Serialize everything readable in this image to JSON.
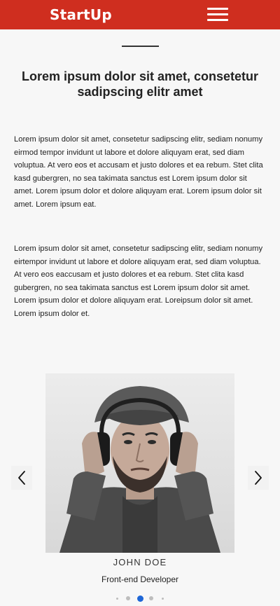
{
  "navbar": {
    "brand": "StartUp",
    "menu_icon": "hamburger-menu-icon",
    "color": "#cf2e1f"
  },
  "section": {
    "heading": "Lorem ipsum dolor sit amet, consetetur sadipscing elitr amet",
    "paragraphs": [
      "Lorem ipsum dolor sit amet, consetetur sadipscing elitr, sediam nonumy eirmod tempor invidunt ut labore et dolore aliquyam erat, sed diam voluptua. At vero eos et accusam et justo dolores et ea rebum. Stet clita kasd gubergren, no sea takimata sanctus est Lorem ipsum dolor sit amet. Lorem ipsum dolor et dolore aliquyam erat. Lorem ipsum dolor sit amet. Lorem ipsum eat.",
      "Lorem ipsum dolor sit amet, consetetur sadipscing elitr, sediam nonumy eirtempor invidunt ut labore et dolore aliquyam erat, sed diam voluptua. At vero eos eaccusam et justo dolores et ea rebum. Stet clita kasd gubergren, no sea takimata sanctus est Lorem ipsum dolor sit amet. Lorem ipsum dolor et dolore aliquyam erat. Loreipsum dolor sit amet. Lorem ipsum dolor et."
    ]
  },
  "carousel": {
    "prev_icon": "chevron-left-icon",
    "next_icon": "chevron-right-icon",
    "name": "JOHN DOE",
    "role": "Front-end Developer",
    "active_index": 2,
    "dot_count": 5,
    "active_color": "#1e66d6"
  }
}
